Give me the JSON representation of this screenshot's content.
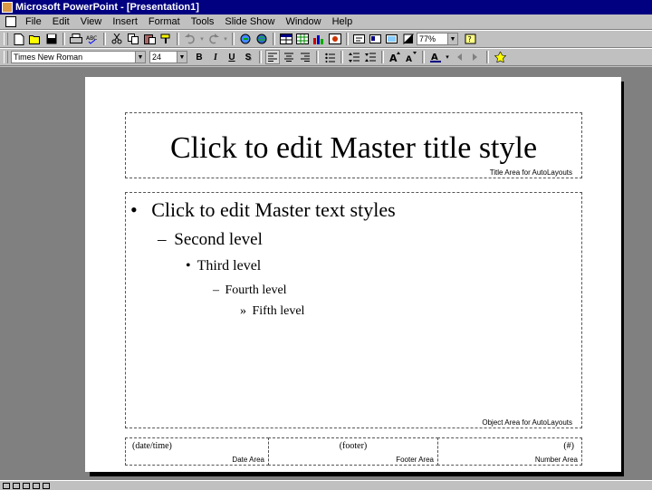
{
  "window": {
    "title": "Microsoft PowerPoint - [Presentation1]"
  },
  "menu": [
    "File",
    "Edit",
    "View",
    "Insert",
    "Format",
    "Tools",
    "Slide Show",
    "Window",
    "Help"
  ],
  "standard_toolbar": {
    "zoom": "77%"
  },
  "formatting_toolbar": {
    "font": "Times New Roman",
    "size": "24",
    "bold": "B",
    "italic": "I",
    "underline": "U",
    "shadow": "S"
  },
  "slide": {
    "title": "Click to edit Master title style",
    "title_area_label": "Title Area for AutoLayouts",
    "body_levels": [
      {
        "bullet": "•",
        "text": "Click to edit Master text styles"
      },
      {
        "bullet": "–",
        "text": "Second level"
      },
      {
        "bullet": "•",
        "text": "Third level"
      },
      {
        "bullet": "–",
        "text": "Fourth level"
      },
      {
        "bullet": "»",
        "text": "Fifth level"
      }
    ],
    "object_area_label": "Object Area for AutoLayouts",
    "date_value": "(date/time)",
    "date_label": "Date Area",
    "footer_value": "(footer)",
    "footer_label": "Footer Area",
    "number_value": "(#)",
    "number_label": "Number Area"
  },
  "colors": {
    "titlebar": "#000080",
    "chrome": "#c0c0c0",
    "workspace": "#808080",
    "slide": "#ffffff"
  }
}
